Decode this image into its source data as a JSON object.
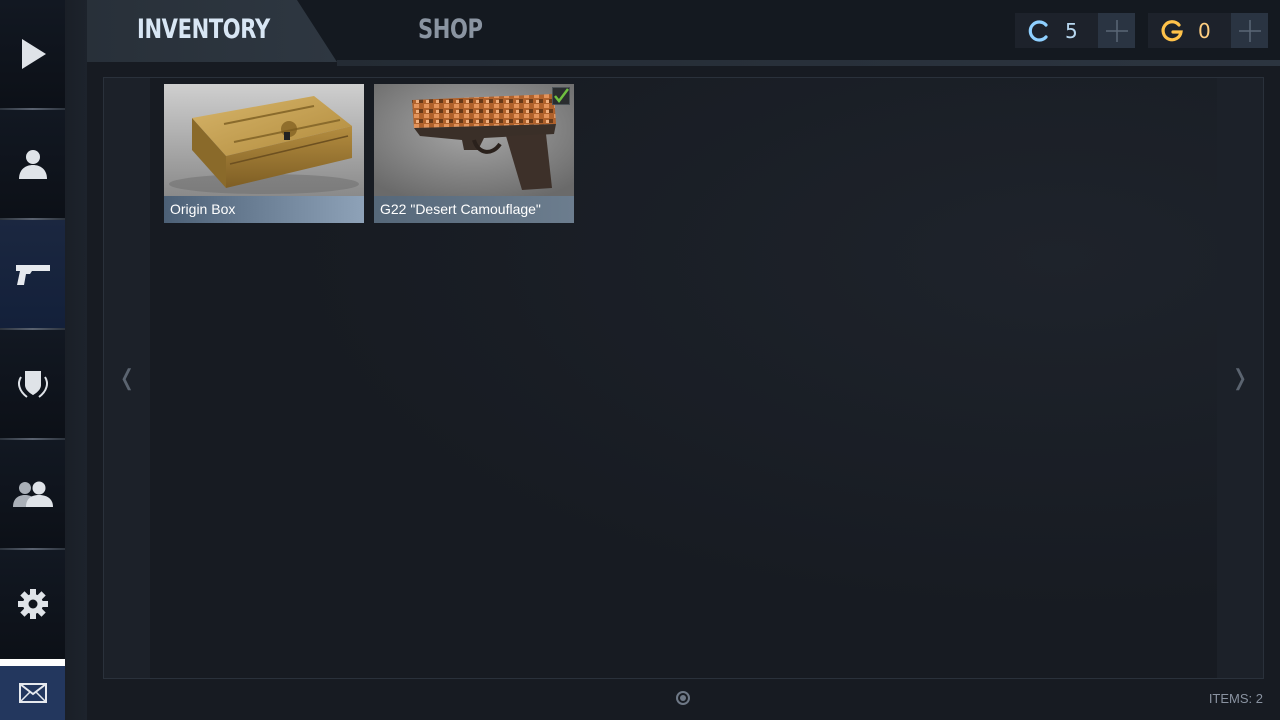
{
  "header": {
    "tabs": [
      {
        "label": "INVENTORY",
        "active": true
      },
      {
        "label": "SHOP",
        "active": false
      }
    ],
    "currencies": [
      {
        "icon": "credits-c-icon",
        "value": "5",
        "color": "#8fd0ff"
      },
      {
        "icon": "gold-g-icon",
        "value": "0",
        "color": "#ffc24a"
      }
    ]
  },
  "sidebar": {
    "items": [
      {
        "icon": "play-icon",
        "active": false
      },
      {
        "icon": "profile-icon",
        "active": false
      },
      {
        "icon": "pistol-icon",
        "active": true
      },
      {
        "icon": "rank-badge-icon",
        "active": false
      },
      {
        "icon": "friends-icon",
        "active": false
      },
      {
        "icon": "gear-icon",
        "active": false
      },
      {
        "icon": "mail-icon",
        "active": false
      }
    ]
  },
  "inventory": {
    "items": [
      {
        "name": "Origin Box",
        "type": "case",
        "equipped": false
      },
      {
        "name": "G22 \"Desert Camouflage\"",
        "type": "pistol",
        "equipped": true
      }
    ],
    "nav_prev": "❬",
    "nav_next": "❭"
  },
  "footer": {
    "items_count": "ITEMS: 2"
  }
}
